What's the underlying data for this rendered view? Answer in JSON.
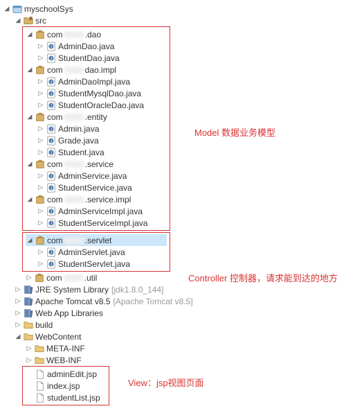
{
  "project": {
    "name": "myschoolSys"
  },
  "src": {
    "label": "src"
  },
  "packages": {
    "dao": {
      "prefix": "com",
      "suffix": ".dao"
    },
    "daoimpl": {
      "prefix": "com",
      "suffix": "dao.impl"
    },
    "entity": {
      "prefix": "com",
      "suffix": ".entity"
    },
    "service": {
      "prefix": "com",
      "suffix": ".service"
    },
    "serviceimpl": {
      "prefix": "com",
      "suffix": ".service.impl"
    },
    "servlet": {
      "prefix": "com",
      "suffix": ".servlet"
    },
    "util": {
      "prefix": "com",
      "suffix": ".util"
    }
  },
  "files": {
    "dao": [
      "AdminDao.java",
      "StudentDao.java"
    ],
    "daoimpl": [
      "AdminDaoImpl.java",
      "StudentMysqlDao.java",
      "StudentOracleDao.java"
    ],
    "entity": [
      "Admin.java",
      "Grade.java",
      "Student.java"
    ],
    "service": [
      "AdminService.java",
      "StudentService.java"
    ],
    "serviceimpl": [
      "AdminServiceImpl.java",
      "StudentServiceImpl.java"
    ],
    "servlet": [
      "AdminServlet.java",
      "StudentServlet.java"
    ]
  },
  "libs": {
    "jre": {
      "label": "JRE System Library",
      "decor": "[jdk1.8.0_144]"
    },
    "tomcat": {
      "label": "Apache Tomcat v8.5",
      "decor": "[Apache Tomcat v8.5]"
    },
    "webapp": {
      "label": "Web App Libraries"
    }
  },
  "folders": {
    "build": "build",
    "webcontent": "WebContent",
    "meta": "META-INF",
    "webinf": "WEB-INF"
  },
  "jsp": [
    "adminEdit.jsp",
    "index.jsp",
    "studentList.jsp"
  ],
  "annotations": {
    "model": "Model 数据业务模型",
    "controller": "Controller 控制器，请求能到达的地方",
    "view": "View：jsp视图页面"
  },
  "twister": {
    "expanded": "◢",
    "collapsed": "▷"
  }
}
